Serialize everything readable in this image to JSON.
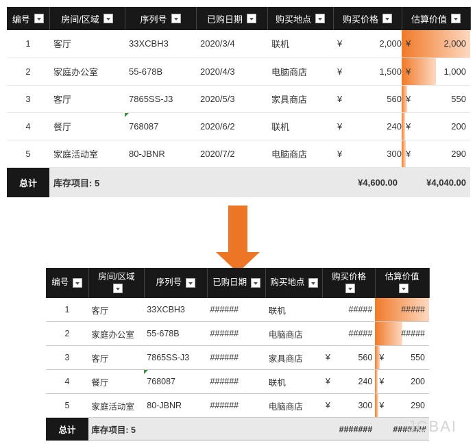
{
  "header": {
    "cols": [
      "编号",
      "房间/区域",
      "序列号",
      "已购日期",
      "购买地点",
      "购买价格",
      "估算价值"
    ]
  },
  "rows": [
    {
      "idx": "1",
      "room": "客厅",
      "serial": "33XCBH3",
      "date": "2020/3/4",
      "place": "联机",
      "price": "2,000",
      "est": "2,000",
      "bar": 1.0
    },
    {
      "idx": "2",
      "room": "家庭办公室",
      "serial": "55-678B",
      "date": "2020/4/3",
      "place": "电脑商店",
      "price": "1,500",
      "est": "1,000",
      "bar": 0.5
    },
    {
      "idx": "3",
      "room": "客厅",
      "serial": "7865SS-J3",
      "date": "2020/5/3",
      "place": "家具商店",
      "price": "560",
      "est": "550",
      "bar": 0.08
    },
    {
      "idx": "4",
      "room": "餐厅",
      "serial": "768087",
      "date": "2020/6/2",
      "place": "联机",
      "price": "240",
      "est": "200",
      "bar": 0.05
    },
    {
      "idx": "5",
      "room": "家庭活动室",
      "serial": "80-JBNR",
      "date": "2020/7/2",
      "place": "电脑商店",
      "price": "300",
      "est": "290",
      "bar": 0.06
    }
  ],
  "totals": {
    "label": "总计",
    "inv": "库存项目: 5",
    "price": "¥4,600.00",
    "est": "¥4,040.00"
  },
  "narrow_header": {
    "cols": [
      "编号",
      "房间/区域",
      "序列号",
      "已购日期",
      "购买地点",
      "购买价格",
      "估算价值"
    ]
  },
  "narrow_rows": [
    {
      "idx": "1",
      "room": "客厅",
      "serial": "33XCBH3",
      "date": "######",
      "place": "联机",
      "price": "#####",
      "est": "#####",
      "bar": 1.0
    },
    {
      "idx": "2",
      "room": "家庭办公室",
      "serial": "55-678B",
      "date": "######",
      "place": "电脑商店",
      "price": "#####",
      "est": "#####",
      "bar": 0.5
    },
    {
      "idx": "3",
      "room": "客厅",
      "serial": "7865SS-J3",
      "date": "######",
      "place": "家具商店",
      "price_sym": "¥",
      "price": "560",
      "est_sym": "¥",
      "est": "550",
      "bar": 0.08
    },
    {
      "idx": "4",
      "room": "餐厅",
      "serial": "768087",
      "date": "######",
      "place": "联机",
      "price_sym": "¥",
      "price": "240",
      "est_sym": "¥",
      "est": "200",
      "bar": 0.05
    },
    {
      "idx": "5",
      "room": "家庭活动室",
      "serial": "80-JBNR",
      "date": "######",
      "place": "电脑商店",
      "price_sym": "¥",
      "price": "300",
      "est_sym": "¥",
      "est": "290",
      "bar": 0.06
    }
  ],
  "narrow_totals": {
    "label": "总计",
    "inv": "库存项目: 5",
    "price": "#######",
    "est": "#######"
  },
  "currency": "¥",
  "watermark": "JCBAI"
}
